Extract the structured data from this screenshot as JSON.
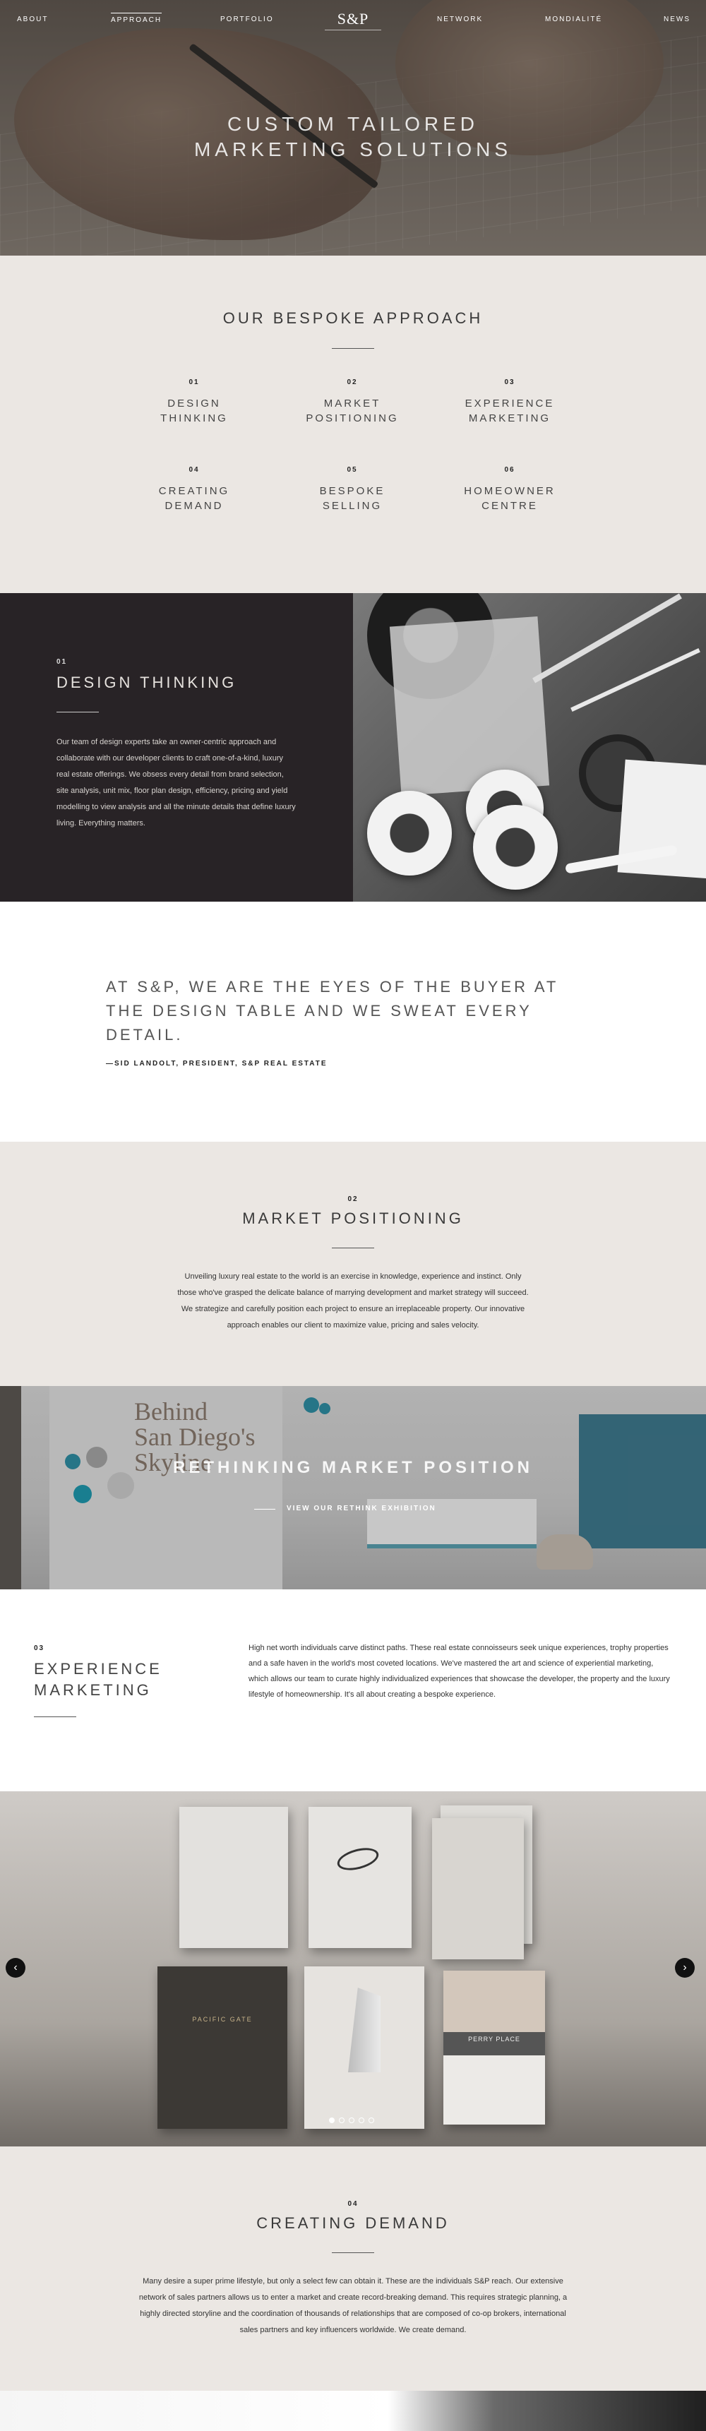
{
  "nav": {
    "left_items": [
      "ABOUT",
      "APPROACH",
      "PORTFOLIO"
    ],
    "logo": "S&P",
    "right_items": [
      "NETWORK",
      "MONDIALITÉ",
      "NEWS"
    ],
    "active": "APPROACH"
  },
  "hero": {
    "line1": "CUSTOM TAILORED",
    "line2": "MARKETING SOLUTIONS"
  },
  "approach": {
    "title": "OUR BESPOKE APPROACH",
    "steps": [
      {
        "num": "01",
        "line1": "DESIGN",
        "line2": "THINKING"
      },
      {
        "num": "02",
        "line1": "MARKET",
        "line2": "POSITIONING"
      },
      {
        "num": "03",
        "line1": "EXPERIENCE",
        "line2": "MARKETING"
      },
      {
        "num": "04",
        "line1": "CREATING",
        "line2": "DEMAND"
      },
      {
        "num": "05",
        "line1": "BESPOKE",
        "line2": "SELLING"
      },
      {
        "num": "06",
        "line1": "HOMEOWNER",
        "line2": "CENTRE"
      }
    ]
  },
  "design_thinking": {
    "num": "01",
    "title": "DESIGN THINKING",
    "body": "Our team of design experts take an owner-centric approach and collaborate with our developer clients to craft one-of-a-kind, luxury real estate offerings. We obsess every detail from brand selection, site analysis, unit mix, floor plan design, efficiency, pricing and yield modelling to view analysis and all the minute details that define luxury living. Everything matters."
  },
  "quote": {
    "text": "AT S&P, WE ARE THE EYES OF THE BUYER AT THE DESIGN TABLE AND WE SWEAT EVERY DETAIL.",
    "author": "—SID LANDOLT, PRESIDENT, S&P REAL ESTATE"
  },
  "market_positioning": {
    "num": "02",
    "title": "MARKET POSITIONING",
    "body": "Unveiling luxury real estate to the world is an exercise in knowledge, experience and instinct. Only those who've grasped the delicate balance of marrying development and market strategy will succeed. We strategize and carefully position each project to ensure an irreplaceable property. Our innovative approach enables our client to maximize value, pricing and sales velocity."
  },
  "exhibition": {
    "wall_text": [
      "Behind",
      "San Diego's",
      "Skyline"
    ],
    "title": "RETHINKING MARKET POSITION",
    "link": "VIEW OUR RETHINK EXHIBITION"
  },
  "experience_marketing": {
    "num": "03",
    "title_line1": "EXPERIENCE",
    "title_line2": "MARKETING",
    "body": "High net worth individuals carve distinct paths. These real estate connoisseurs seek unique experiences, trophy properties and a safe haven in the world's most coveted locations. We've mastered the art and science of experiential marketing, which allows our team to curate highly individualized experiences that showcase the developer, the property and the luxury lifestyle of homeownership. It's all about creating a bespoke experience."
  },
  "carousel": {
    "prev_icon": "chevron-left-icon",
    "next_icon": "chevron-right-icon",
    "slides": 5,
    "active_slide": 1,
    "book_labels": [
      "PACIFIC GATE",
      "PERRY PLACE"
    ]
  },
  "creating_demand": {
    "num": "04",
    "title": "CREATING DEMAND",
    "body": "Many desire a super prime lifestyle, but only a select few can obtain it. These are the individuals S&P reach. Our extensive network of sales partners allows us to enter a market and create record-breaking demand. This requires strategic planning, a highly directed storyline and the coordination of thousands of relationships that are composed of co-op brokers, international sales partners and key influencers worldwide. We create demand."
  }
}
